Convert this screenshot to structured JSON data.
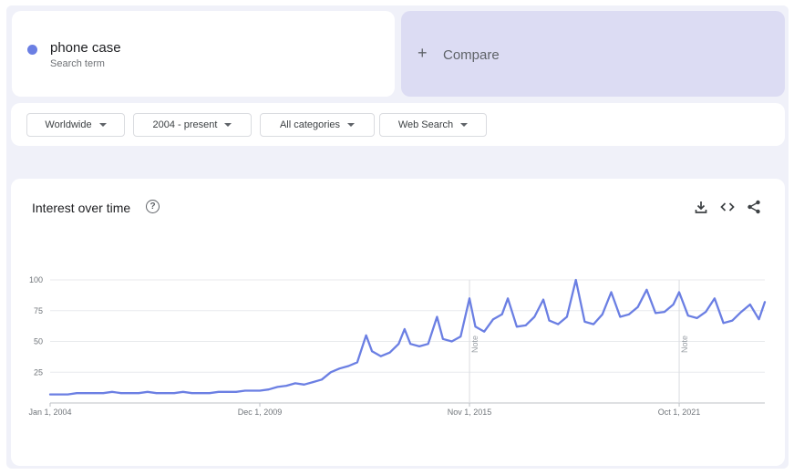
{
  "search_term": {
    "name": "phone case",
    "subtitle": "Search term",
    "color": "#6b7fe3"
  },
  "compare": {
    "label": "Compare"
  },
  "filters": {
    "region": "Worldwide",
    "time_range": "2004 - present",
    "category": "All categories",
    "search_type": "Web Search"
  },
  "chart_header": {
    "title": "Interest over time",
    "help_icon": "question-circle-icon",
    "actions": [
      "download-icon",
      "embed-code-icon",
      "share-icon"
    ]
  },
  "chart_data": {
    "type": "line",
    "series_color": "#6b7fe3",
    "x_ticks": [
      "Jan 1, 2004",
      "Dec 1, 2009",
      "Nov 1, 2015",
      "Oct 1, 2021"
    ],
    "x_tick_dates": [
      "2004-01",
      "2009-12",
      "2015-11",
      "2021-10"
    ],
    "y_ticks": [
      25,
      50,
      75,
      100
    ],
    "ylim": [
      0,
      100
    ],
    "xlim": [
      "2004-01",
      "2024-03"
    ],
    "grid": true,
    "notes": [
      {
        "date": "2015-11",
        "label": "Note"
      },
      {
        "date": "2021-10",
        "label": "Note"
      }
    ],
    "points": [
      [
        "2004-01",
        7
      ],
      [
        "2004-04",
        7
      ],
      [
        "2004-07",
        7
      ],
      [
        "2004-10",
        8
      ],
      [
        "2005-01",
        8
      ],
      [
        "2005-04",
        8
      ],
      [
        "2005-07",
        8
      ],
      [
        "2005-10",
        9
      ],
      [
        "2006-01",
        8
      ],
      [
        "2006-04",
        8
      ],
      [
        "2006-07",
        8
      ],
      [
        "2006-10",
        9
      ],
      [
        "2007-01",
        8
      ],
      [
        "2007-04",
        8
      ],
      [
        "2007-07",
        8
      ],
      [
        "2007-10",
        9
      ],
      [
        "2008-01",
        8
      ],
      [
        "2008-04",
        8
      ],
      [
        "2008-07",
        8
      ],
      [
        "2008-10",
        9
      ],
      [
        "2009-01",
        9
      ],
      [
        "2009-04",
        9
      ],
      [
        "2009-07",
        10
      ],
      [
        "2009-12",
        10
      ],
      [
        "2010-03",
        11
      ],
      [
        "2010-06",
        13
      ],
      [
        "2010-09",
        14
      ],
      [
        "2010-12",
        16
      ],
      [
        "2011-03",
        15
      ],
      [
        "2011-06",
        17
      ],
      [
        "2011-09",
        19
      ],
      [
        "2011-12",
        25
      ],
      [
        "2012-03",
        28
      ],
      [
        "2012-06",
        30
      ],
      [
        "2012-09",
        33
      ],
      [
        "2012-12",
        55
      ],
      [
        "2013-02",
        42
      ],
      [
        "2013-05",
        38
      ],
      [
        "2013-08",
        41
      ],
      [
        "2013-11",
        48
      ],
      [
        "2014-01",
        60
      ],
      [
        "2014-03",
        48
      ],
      [
        "2014-06",
        46
      ],
      [
        "2014-09",
        48
      ],
      [
        "2014-12",
        70
      ],
      [
        "2015-02",
        52
      ],
      [
        "2015-05",
        50
      ],
      [
        "2015-08",
        54
      ],
      [
        "2015-11",
        85
      ],
      [
        "2016-01",
        62
      ],
      [
        "2016-04",
        58
      ],
      [
        "2016-07",
        68
      ],
      [
        "2016-10",
        72
      ],
      [
        "2016-12",
        85
      ],
      [
        "2017-03",
        62
      ],
      [
        "2017-06",
        63
      ],
      [
        "2017-09",
        70
      ],
      [
        "2017-12",
        84
      ],
      [
        "2018-02",
        67
      ],
      [
        "2018-05",
        64
      ],
      [
        "2018-08",
        70
      ],
      [
        "2018-11",
        100
      ],
      [
        "2019-02",
        66
      ],
      [
        "2019-05",
        64
      ],
      [
        "2019-08",
        72
      ],
      [
        "2019-11",
        90
      ],
      [
        "2020-02",
        70
      ],
      [
        "2020-05",
        72
      ],
      [
        "2020-08",
        78
      ],
      [
        "2020-11",
        92
      ],
      [
        "2021-02",
        73
      ],
      [
        "2021-05",
        74
      ],
      [
        "2021-08",
        80
      ],
      [
        "2021-10",
        90
      ],
      [
        "2022-01",
        71
      ],
      [
        "2022-04",
        69
      ],
      [
        "2022-07",
        74
      ],
      [
        "2022-10",
        85
      ],
      [
        "2023-01",
        65
      ],
      [
        "2023-04",
        67
      ],
      [
        "2023-07",
        74
      ],
      [
        "2023-10",
        80
      ],
      [
        "2024-01",
        68
      ],
      [
        "2024-03",
        82
      ]
    ]
  }
}
